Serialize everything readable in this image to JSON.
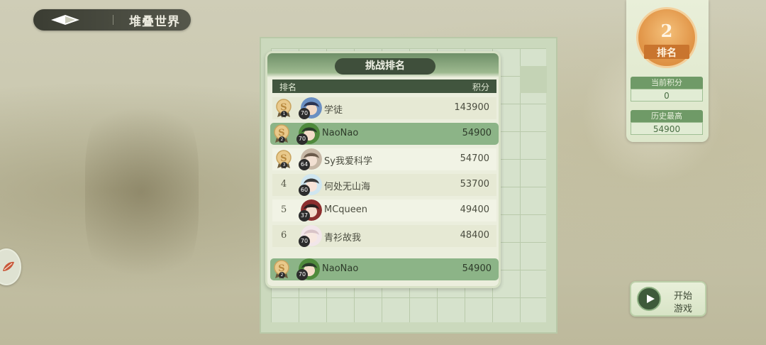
{
  "topbar": {
    "title": "堆叠世界"
  },
  "ranking": {
    "title": "挑战排名",
    "col_rank": "排名",
    "col_score": "积分",
    "rows": [
      {
        "rank": "1",
        "level": "70",
        "name": "学徒",
        "score": "143900",
        "style": "odd"
      },
      {
        "rank": "2",
        "level": "70",
        "name": "NaoNao",
        "score": "54900",
        "style": "hl"
      },
      {
        "rank": "3",
        "level": "64",
        "name": "Sy我爱科学",
        "score": "54700",
        "style": "even"
      },
      {
        "rank": "4",
        "level": "60",
        "name": "何处无山海",
        "score": "53700",
        "style": "odd"
      },
      {
        "rank": "5",
        "level": "37",
        "name": "MCqueen",
        "score": "49400",
        "style": "even"
      },
      {
        "rank": "6",
        "level": "70",
        "name": "青衫故我",
        "score": "48400",
        "style": "odd"
      }
    ],
    "self": {
      "rank": "2",
      "level": "70",
      "name": "NaoNao",
      "score": "54900"
    }
  },
  "rank_card": {
    "rank": "2",
    "label": "排名",
    "current_score_label": "当前积分",
    "current_score": "0",
    "best_label": "历史最高",
    "best": "54900"
  },
  "start_button": {
    "line1": "开始",
    "line2": "游戏"
  },
  "colors": {
    "accent": "#6f9a67",
    "highlight": "#8cb487",
    "badge": "#e2974a"
  }
}
